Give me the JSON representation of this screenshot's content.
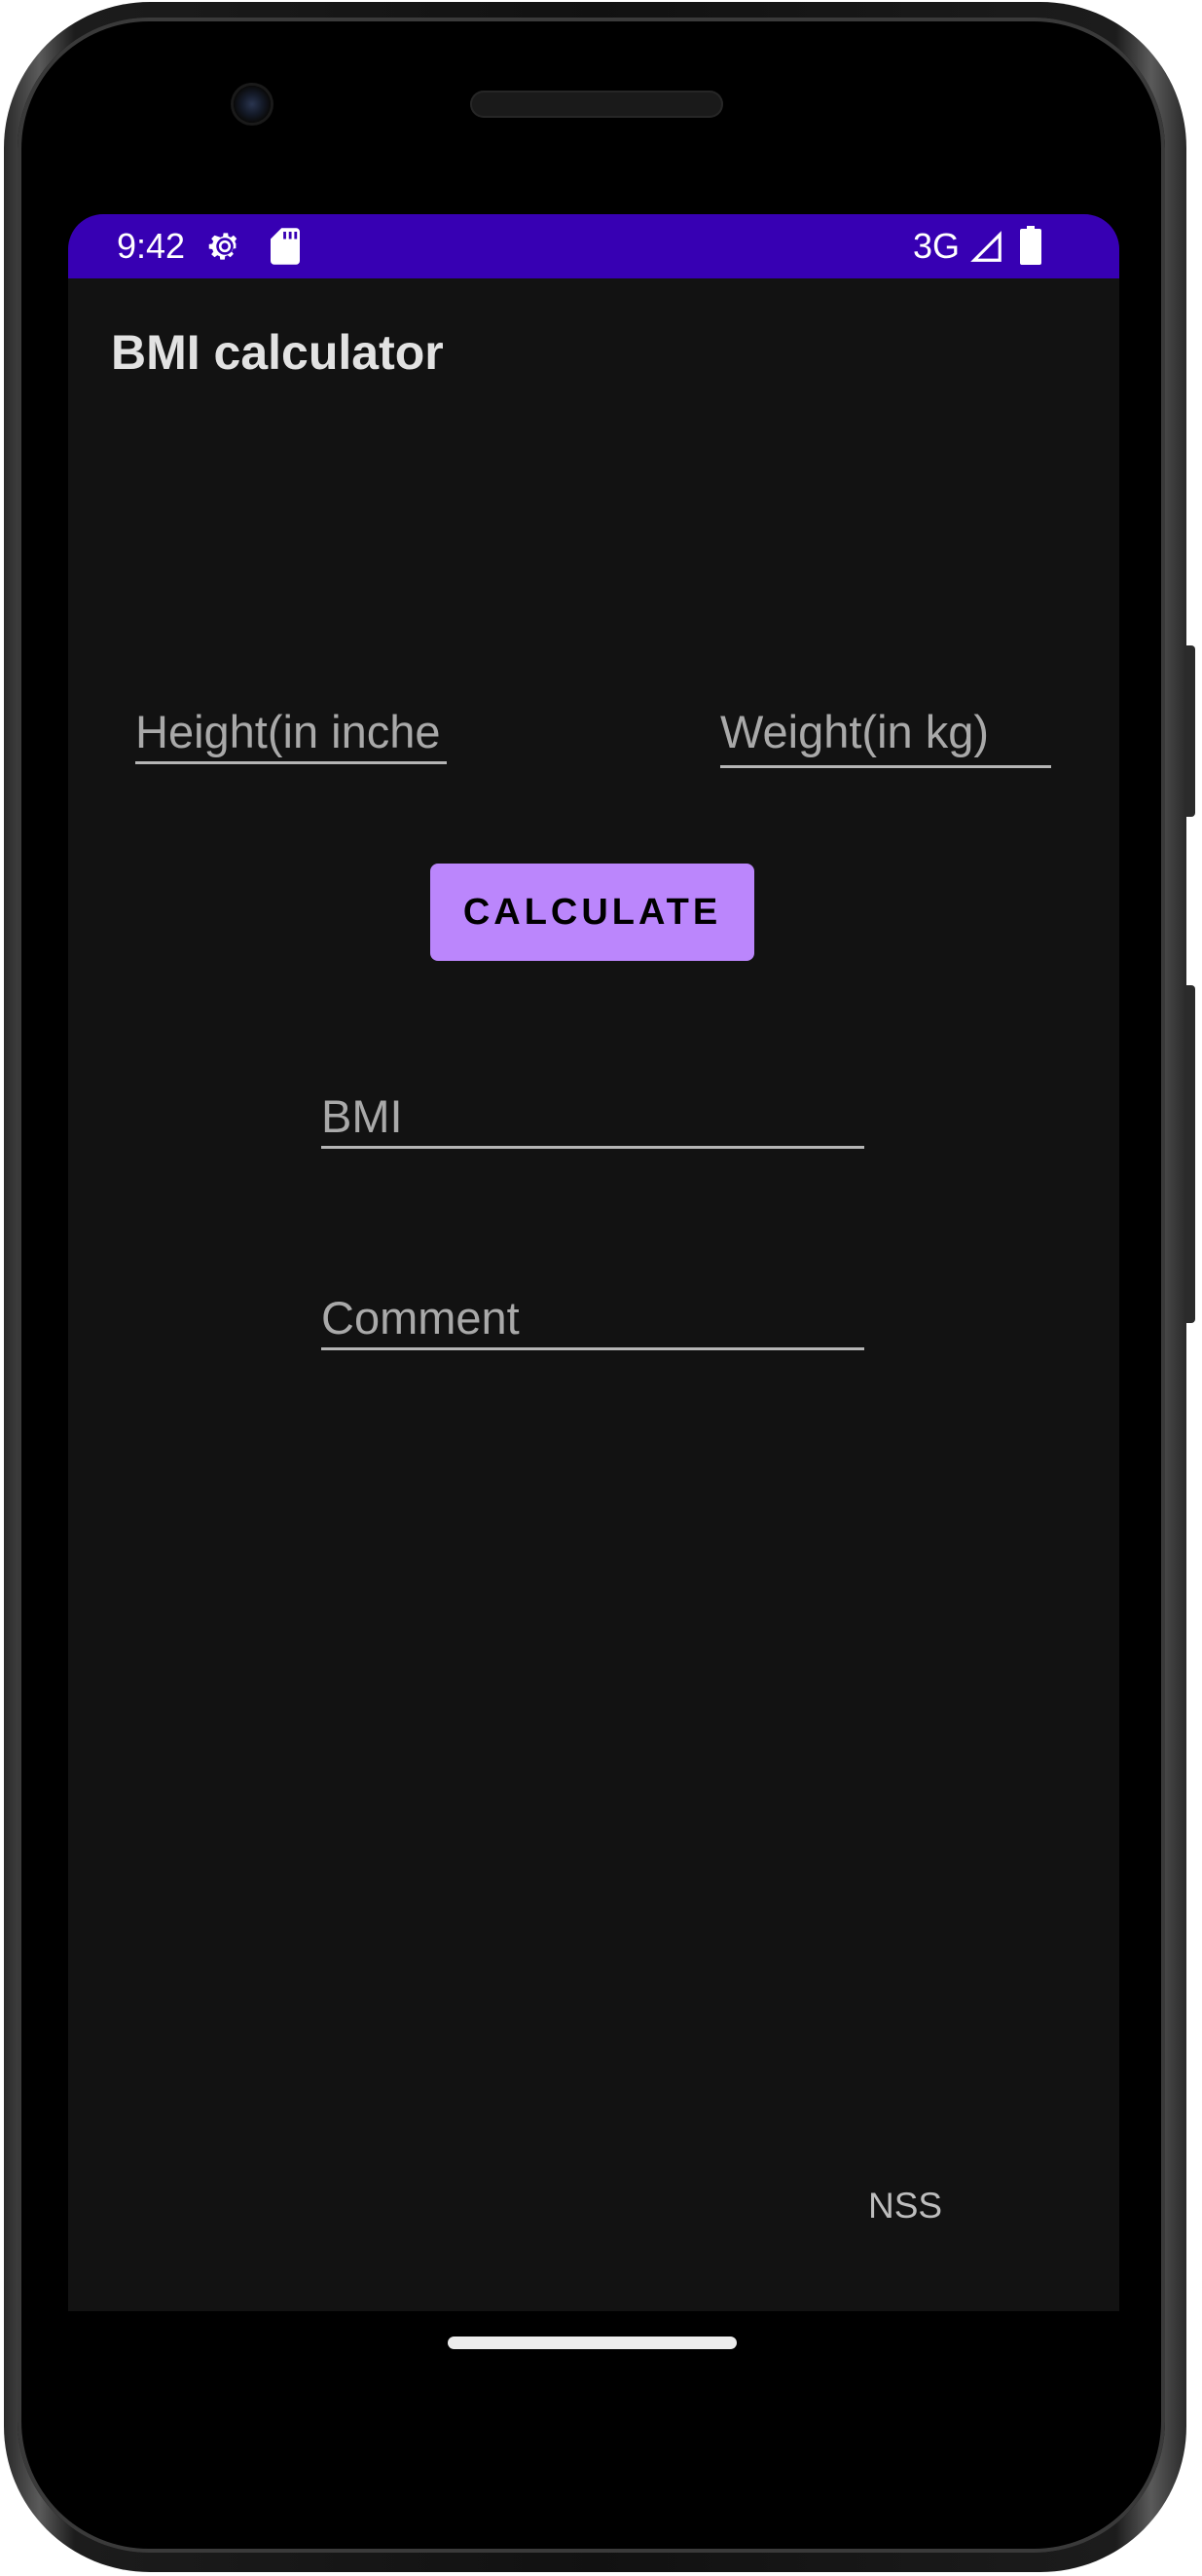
{
  "status_bar": {
    "time": "9:42",
    "network": "3G",
    "icons": [
      "settings-gear-icon",
      "sd-card-icon",
      "signal-icon",
      "battery-icon"
    ],
    "background_color": "#3700b3"
  },
  "app": {
    "title": "BMI calculator"
  },
  "form": {
    "height_placeholder": "Height(in inches)",
    "height_visible": "Height(in inche",
    "weight_placeholder": "Weight(in kg)",
    "calculate_label": "CALCULATE",
    "bmi_placeholder": "BMI",
    "comment_placeholder": "Comment"
  },
  "footer": {
    "label": "NSS"
  },
  "colors": {
    "screen_background": "#121212",
    "accent_button": "#bb86fc",
    "status_bar": "#3700b3"
  }
}
